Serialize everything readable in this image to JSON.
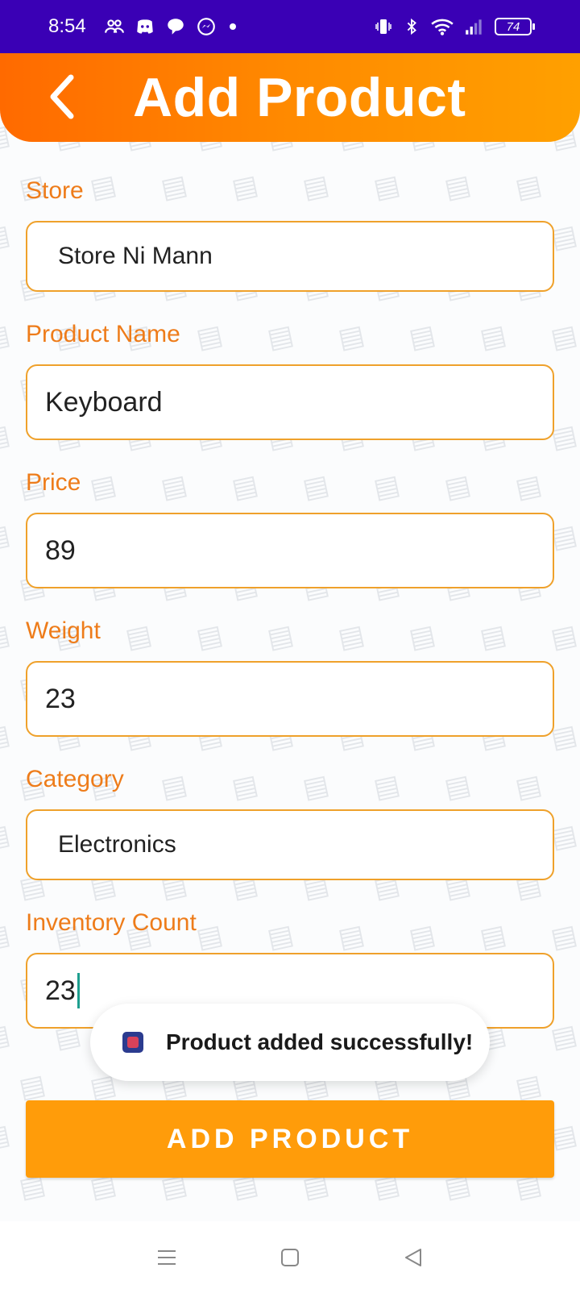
{
  "status_bar": {
    "time": "8:54",
    "battery": "74",
    "icons": [
      "people-icon",
      "discord-icon",
      "chat-bubble-icon",
      "messenger-icon",
      "dot-icon",
      "vibrate-icon",
      "bluetooth-icon",
      "wifi-icon",
      "signal-icon",
      "battery-icon"
    ]
  },
  "app_bar": {
    "title": "Add Product",
    "back_icon": "chevron-left-icon",
    "gradient": [
      "#ff6a00",
      "#ffa000"
    ]
  },
  "form": {
    "store": {
      "label": "Store",
      "value": "Store Ni Mann"
    },
    "product_name": {
      "label": "Product Name",
      "value": "Keyboard"
    },
    "price": {
      "label": "Price",
      "value": "89"
    },
    "weight": {
      "label": "Weight",
      "value": "23"
    },
    "category": {
      "label": "Category",
      "value": "Electronics"
    },
    "inventory_count": {
      "label": "Inventory Count",
      "value": "23"
    }
  },
  "toast": {
    "text": "Product added successfully!"
  },
  "submit_button": {
    "label": "ADD PRODUCT",
    "color": "#ff9c0a"
  },
  "colors": {
    "status_bar": "#3a00b5",
    "label": "#ee7c1a",
    "field_border": "#efa12b"
  },
  "nav_bar": {
    "icons": [
      "menu-icon",
      "home-square-icon",
      "back-triangle-icon"
    ]
  }
}
